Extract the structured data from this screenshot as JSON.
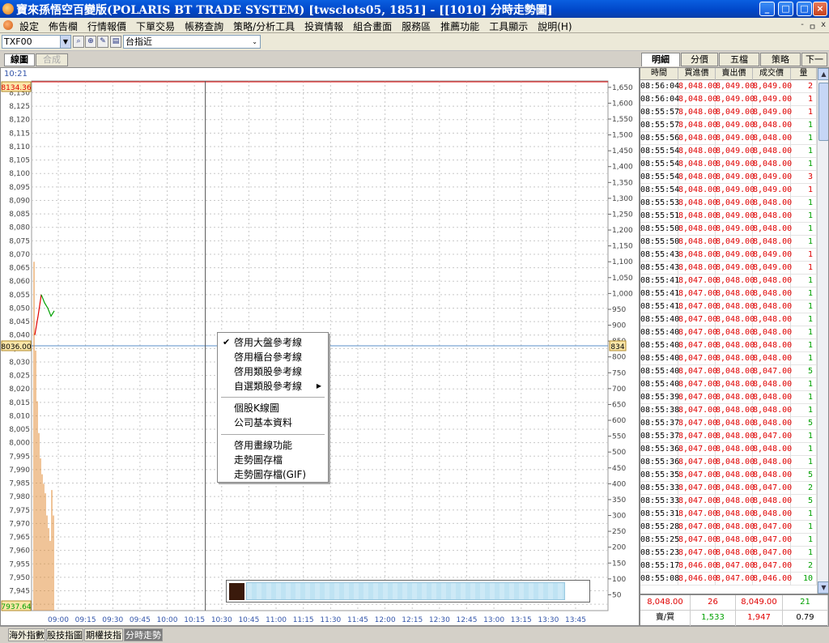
{
  "window": {
    "title": "寶來孫悟空百變版(POLARIS BT TRADE SYSTEM)   [twsclots05, 1851] - [[1010] 分時走勢圖]",
    "controls": [
      "_",
      "□",
      "×"
    ]
  },
  "menu": {
    "items": [
      "設定",
      "佈告欄",
      "行情報價",
      "下單交易",
      "帳務查詢",
      "策略/分析工具",
      "投資情報",
      "組合畫面",
      "服務區",
      "推薦功能",
      "工具顯示",
      "說明(H)"
    ],
    "mdi_controls": [
      "-",
      "ㅁ",
      "x"
    ]
  },
  "toolbar": {
    "symbol": "TXF00",
    "name": "台指近"
  },
  "chart_tabs": [
    "線圖",
    "合成"
  ],
  "chart": {
    "time_label": "10:21",
    "high_label": "8134.36",
    "ref_label": "8036.00",
    "low_label": "7937.64",
    "ref_right_label": "834"
  },
  "chart_data": {
    "type": "line",
    "left_axis_ticks": [
      8130,
      8125,
      8120,
      8115,
      8110,
      8105,
      8100,
      8095,
      8090,
      8085,
      8080,
      8075,
      8070,
      8065,
      8060,
      8055,
      8050,
      8045,
      8040,
      8035,
      8030,
      8025,
      8020,
      8015,
      8010,
      8005,
      8000,
      7995,
      7990,
      7985,
      7980,
      7975,
      7970,
      7965,
      7960,
      7955,
      7950,
      7945,
      7940
    ],
    "left_axis_labels": [
      "8,130",
      "8,125",
      "8,120",
      "8,115",
      "8,110",
      "8,105",
      "8,100",
      "8,095",
      "8,090",
      "8,085",
      "8,080",
      "8,075",
      "8,070",
      "8,065",
      "8,060",
      "8,055",
      "8,050",
      "8,045",
      "8,040",
      "8,035",
      "8,030",
      "8,025",
      "8,020",
      "8,015",
      "8,010",
      "8,005",
      "8,000",
      "7,995",
      "7,990",
      "7,985",
      "7,980",
      "7,975",
      "7,970",
      "7,965",
      "7,960",
      "7,955",
      "7,950",
      "7,945",
      "7,940"
    ],
    "right_axis_ticks": [
      1650,
      1600,
      1550,
      1500,
      1450,
      1400,
      1350,
      1300,
      1250,
      1200,
      1150,
      1100,
      1050,
      1000,
      950,
      900,
      850,
      800,
      750,
      700,
      650,
      600,
      550,
      500,
      450,
      400,
      350,
      300,
      250,
      200,
      150,
      100,
      50
    ],
    "right_axis_labels": [
      "1,650",
      "1,600",
      "1,550",
      "1,500",
      "1,450",
      "1,400",
      "1,350",
      "1,300",
      "1,250",
      "1,200",
      "1,150",
      "1,100",
      "1,050",
      "1,000",
      "950",
      "900",
      "850",
      "800",
      "750",
      "700",
      "650",
      "600",
      "550",
      "500",
      "450",
      "400",
      "350",
      "300",
      "250",
      "200",
      "150",
      "100",
      "50"
    ],
    "x_labels": [
      "09:00",
      "09:15",
      "09:30",
      "09:45",
      "10:00",
      "10:15",
      "10:30",
      "10:45",
      "11:00",
      "11:15",
      "11:30",
      "11:45",
      "12:00",
      "12:15",
      "12:30",
      "12:45",
      "13:00",
      "13:15",
      "13:30",
      "13:45"
    ],
    "ylim": [
      7937.64,
      8134.36
    ],
    "volume_ylim": [
      0,
      1670
    ],
    "reference_price": 8036.0,
    "price_series": [
      8040,
      8047,
      8055,
      8052,
      8050,
      8047,
      8049
    ],
    "volume_series": [
      1100,
      820,
      660,
      560,
      480,
      430,
      400,
      370,
      300,
      260,
      220,
      380,
      300
    ],
    "cursor_time": "10:21"
  },
  "context_menu": {
    "items": [
      {
        "label": "啓用大盤參考線",
        "checked": true
      },
      {
        "label": "啓用櫃台參考線"
      },
      {
        "label": "啓用類股參考線"
      },
      {
        "label": "自選類股參考線",
        "submenu": true
      },
      {
        "label": "個股K線圖"
      },
      {
        "label": "公司基本資料"
      },
      {
        "label": "啓用畫線功能"
      },
      {
        "label": "走勢圖存檔"
      },
      {
        "label": "走勢圖存檔(GIF)"
      }
    ],
    "check_mark": "✔",
    "submenu_arrow": "▶"
  },
  "progress": {
    "fill_fraction": 0.93
  },
  "right_tabs": [
    "明細",
    "分價",
    "五檔",
    "策略",
    "下一頁"
  ],
  "ticks_table": {
    "headers": [
      "時間",
      "買進價",
      "賣出價",
      "成交價",
      "量"
    ],
    "rows": [
      [
        "08:56:04",
        "8,048.00",
        "8,049.00",
        "8,049.00",
        "2"
      ],
      [
        "08:56:04",
        "8,048.00",
        "8,049.00",
        "8,049.00",
        "1"
      ],
      [
        "08:55:57",
        "8,048.00",
        "8,049.00",
        "8,049.00",
        "1"
      ],
      [
        "08:55:57",
        "8,048.00",
        "8,049.00",
        "8,048.00",
        "1"
      ],
      [
        "08:55:56",
        "8,048.00",
        "8,049.00",
        "8,048.00",
        "1"
      ],
      [
        "08:55:54",
        "8,048.00",
        "8,049.00",
        "8,048.00",
        "1"
      ],
      [
        "08:55:54",
        "8,048.00",
        "8,049.00",
        "8,048.00",
        "1"
      ],
      [
        "08:55:54",
        "8,048.00",
        "8,049.00",
        "8,049.00",
        "3"
      ],
      [
        "08:55:54",
        "8,048.00",
        "8,049.00",
        "8,049.00",
        "1"
      ],
      [
        "08:55:53",
        "8,048.00",
        "8,049.00",
        "8,048.00",
        "1"
      ],
      [
        "08:55:51",
        "8,048.00",
        "8,049.00",
        "8,048.00",
        "1"
      ],
      [
        "08:55:50",
        "8,048.00",
        "8,049.00",
        "8,048.00",
        "1"
      ],
      [
        "08:55:50",
        "8,048.00",
        "8,049.00",
        "8,048.00",
        "1"
      ],
      [
        "08:55:43",
        "8,048.00",
        "8,049.00",
        "8,049.00",
        "1"
      ],
      [
        "08:55:43",
        "8,048.00",
        "8,049.00",
        "8,049.00",
        "1"
      ],
      [
        "08:55:41",
        "8,047.00",
        "8,048.00",
        "8,048.00",
        "1"
      ],
      [
        "08:55:41",
        "8,047.00",
        "8,048.00",
        "8,048.00",
        "1"
      ],
      [
        "08:55:41",
        "8,047.00",
        "8,048.00",
        "8,048.00",
        "1"
      ],
      [
        "08:55:40",
        "8,047.00",
        "8,048.00",
        "8,048.00",
        "1"
      ],
      [
        "08:55:40",
        "8,047.00",
        "8,048.00",
        "8,048.00",
        "1"
      ],
      [
        "08:55:40",
        "8,047.00",
        "8,048.00",
        "8,048.00",
        "1"
      ],
      [
        "08:55:40",
        "8,047.00",
        "8,048.00",
        "8,048.00",
        "1"
      ],
      [
        "08:55:40",
        "8,047.00",
        "8,048.00",
        "8,047.00",
        "5"
      ],
      [
        "08:55:40",
        "8,047.00",
        "8,048.00",
        "8,048.00",
        "1"
      ],
      [
        "08:55:39",
        "8,047.00",
        "8,048.00",
        "8,048.00",
        "1"
      ],
      [
        "08:55:38",
        "8,047.00",
        "8,048.00",
        "8,048.00",
        "1"
      ],
      [
        "08:55:37",
        "8,047.00",
        "8,048.00",
        "8,048.00",
        "5"
      ],
      [
        "08:55:37",
        "8,047.00",
        "8,048.00",
        "8,047.00",
        "1"
      ],
      [
        "08:55:36",
        "8,047.00",
        "8,048.00",
        "8,048.00",
        "1"
      ],
      [
        "08:55:36",
        "8,047.00",
        "8,048.00",
        "8,048.00",
        "1"
      ],
      [
        "08:55:35",
        "8,047.00",
        "8,048.00",
        "8,048.00",
        "5"
      ],
      [
        "08:55:33",
        "8,047.00",
        "8,048.00",
        "8,047.00",
        "2"
      ],
      [
        "08:55:33",
        "8,047.00",
        "8,048.00",
        "8,048.00",
        "5"
      ],
      [
        "08:55:31",
        "8,047.00",
        "8,048.00",
        "8,048.00",
        "1"
      ],
      [
        "08:55:28",
        "8,047.00",
        "8,048.00",
        "8,047.00",
        "1"
      ],
      [
        "08:55:25",
        "8,047.00",
        "8,048.00",
        "8,047.00",
        "1"
      ],
      [
        "08:55:23",
        "8,047.00",
        "8,048.00",
        "8,047.00",
        "1"
      ],
      [
        "08:55:17",
        "8,046.00",
        "8,047.00",
        "8,047.00",
        "2"
      ],
      [
        "08:55:08",
        "8,046.00",
        "8,047.00",
        "8,046.00",
        "10"
      ]
    ]
  },
  "summary": {
    "row1": [
      "8,048.00",
      "26",
      "8,049.00",
      "21"
    ],
    "row2": [
      "賣/買",
      "1,533",
      "1,947",
      "0.79"
    ]
  },
  "bottom_tabs": [
    "海外指數",
    "股技指圖",
    "期權技指",
    "分時走勢"
  ],
  "colors": {
    "up_red": "#e00000",
    "down_green": "#00a000",
    "ref_line": "#5a8fc8",
    "volume_bar": "#e08a30",
    "grid": "#c8c8c8"
  }
}
